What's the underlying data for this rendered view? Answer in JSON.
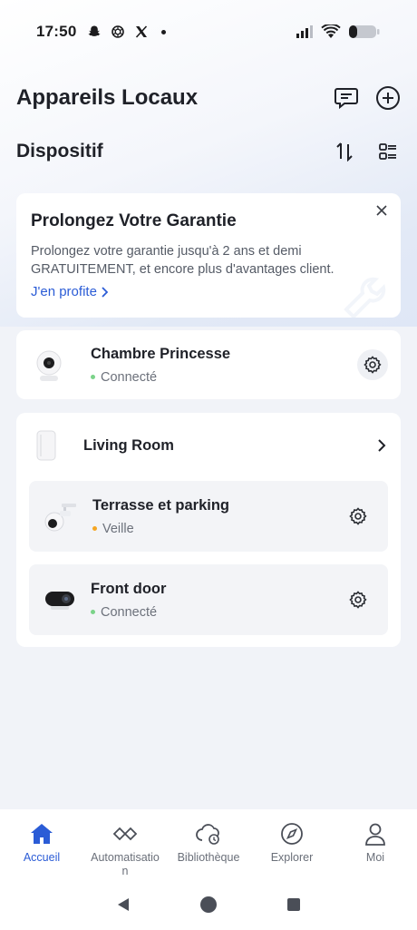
{
  "status_bar": {
    "time": "17:50",
    "icons": [
      "snapchat-icon",
      "chatgpt-icon",
      "x-icon",
      "dot-icon"
    ],
    "right_icons": [
      "signal-icon",
      "wifi-icon",
      "battery-icon"
    ]
  },
  "header": {
    "title": "Appareils Locaux",
    "actions": [
      "message-icon",
      "add-icon"
    ]
  },
  "section": {
    "title": "Dispositif",
    "actions": [
      "sort-icon",
      "grid-view-icon"
    ]
  },
  "promo": {
    "title": "Prolongez Votre Garantie",
    "text": "Prolongez votre garantie jusqu'à 2 ans et demi GRATUITEMENT,  et encore plus d'avantages client.",
    "link": "J'en profite"
  },
  "devices": {
    "chambre": {
      "name": "Chambre Princesse",
      "status": "Connecté",
      "status_color": "#7bd389"
    },
    "group": {
      "name": "Living Room",
      "items": [
        {
          "name": "Terrasse et parking",
          "status": "Veille",
          "status_color": "#f5a623"
        },
        {
          "name": "Front door",
          "status": "Connecté",
          "status_color": "#7bd389"
        }
      ]
    }
  },
  "bottom_nav": {
    "tabs": [
      {
        "label": "Accueil",
        "icon": "home-icon",
        "active": true
      },
      {
        "label": "Automatisation",
        "icon": "automation-icon",
        "active": false
      },
      {
        "label": "Bibliothèque",
        "icon": "library-icon",
        "active": false
      },
      {
        "label": "Explorer",
        "icon": "compass-icon",
        "active": false
      },
      {
        "label": "Moi",
        "icon": "profile-icon",
        "active": false
      }
    ]
  },
  "colors": {
    "accent": "#2b5cd6",
    "background": "#f1f3f8",
    "card": "#ffffff"
  }
}
